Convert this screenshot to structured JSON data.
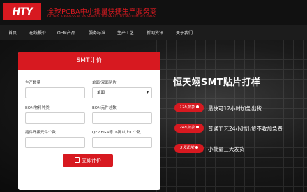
{
  "brand": {
    "logo_text": "HTY",
    "title": "全球PCBA中小批量快捷生产服务商",
    "subtitle": "GLOBAL EXPRESS PCBA SERVICE ON SMALL TO MEDIUM VOLUMES"
  },
  "nav": {
    "items": [
      "首页",
      "在线报价",
      "OEM产品",
      "服务标准",
      "生产工艺",
      "新闻资讯",
      "关于我们"
    ]
  },
  "calculator": {
    "title": "SMT计价",
    "fields": {
      "quantity_label": "生产数量",
      "board_type_label": "单面/双面贴片",
      "board_type_value": "单面",
      "bom_types_label": "BOM物料种类",
      "bom_total_label": "BOM元件总数",
      "plugin_label": "插件焊接元件个数",
      "qfp_label": "QFP BGA等16脚以上IC个数"
    },
    "button_label": "立即计价"
  },
  "hero": {
    "headline": "恒天翊SMT贴片打样",
    "features": [
      {
        "tag": "12h加急",
        "text": "最快可12小时加急出货"
      },
      {
        "tag": "24h加急",
        "text": "普通工艺24小时出货不收加急费"
      },
      {
        "tag": "3天正常",
        "text": "小批量三天发货"
      }
    ]
  },
  "colors": {
    "accent": "#d71920",
    "nav_bg": "#1c1c1c"
  }
}
